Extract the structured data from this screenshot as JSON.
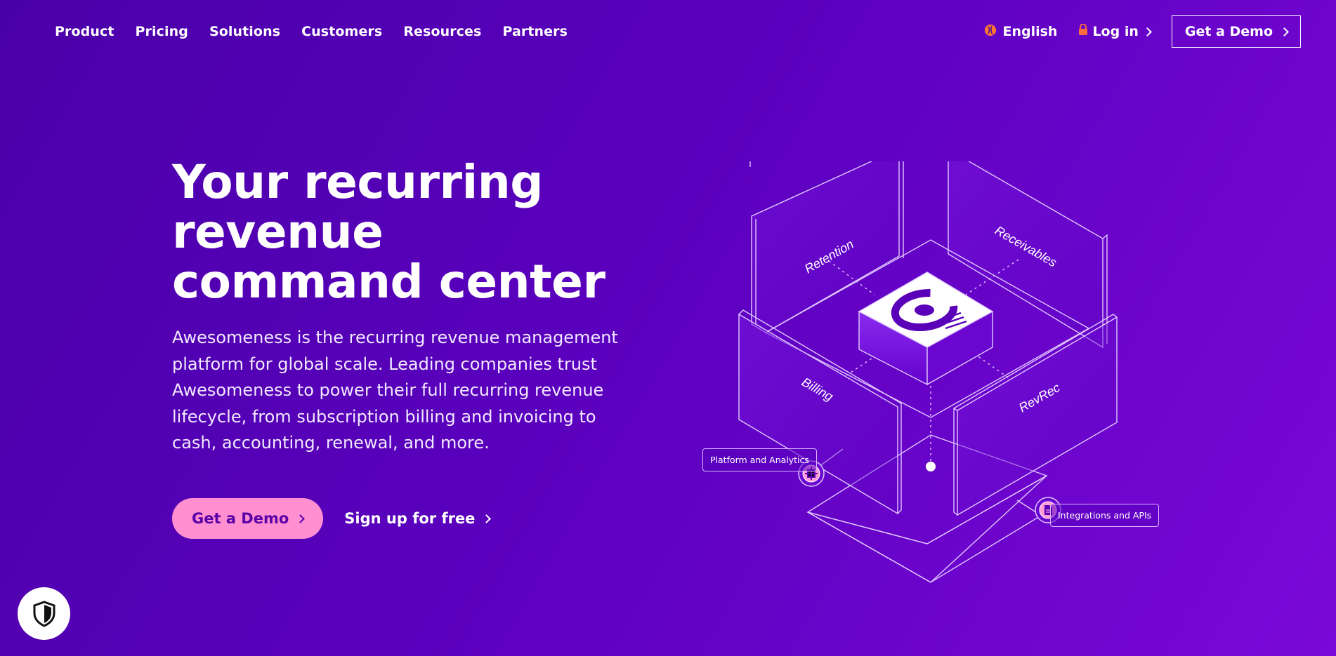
{
  "nav": {
    "links": [
      "Product",
      "Pricing",
      "Solutions",
      "Customers",
      "Resources",
      "Partners"
    ],
    "language": "English",
    "login": "Log in",
    "demo": "Get a Demo"
  },
  "hero": {
    "title": "Your recurring revenue command center",
    "description": "Awesomeness is the recurring revenue management platform for global scale. Leading companies trust Awesomeness to power their full recurring revenue lifecycle, from subscription billing and invoicing to cash, accounting, renewal, and more.",
    "cta_primary": "Get a Demo",
    "cta_secondary": "Sign up for free"
  },
  "illustration": {
    "panels": [
      "Retention",
      "Receivables",
      "Billing",
      "RevRec"
    ],
    "callouts": [
      "Platform and Analytics",
      "Integrations and APIs"
    ]
  },
  "colors": {
    "bg_start": "#4a00a8",
    "bg_end": "#7a08d8",
    "cta_pink": "#ff8fd0",
    "lang_icon": "#ff7a2e",
    "lock_icon": "#ff6b3d"
  },
  "icons": {
    "language": "globe-icon",
    "login": "lock-icon",
    "shield": "shield-icon",
    "platform": "puzzle-icon",
    "integrations": "document-icon"
  }
}
